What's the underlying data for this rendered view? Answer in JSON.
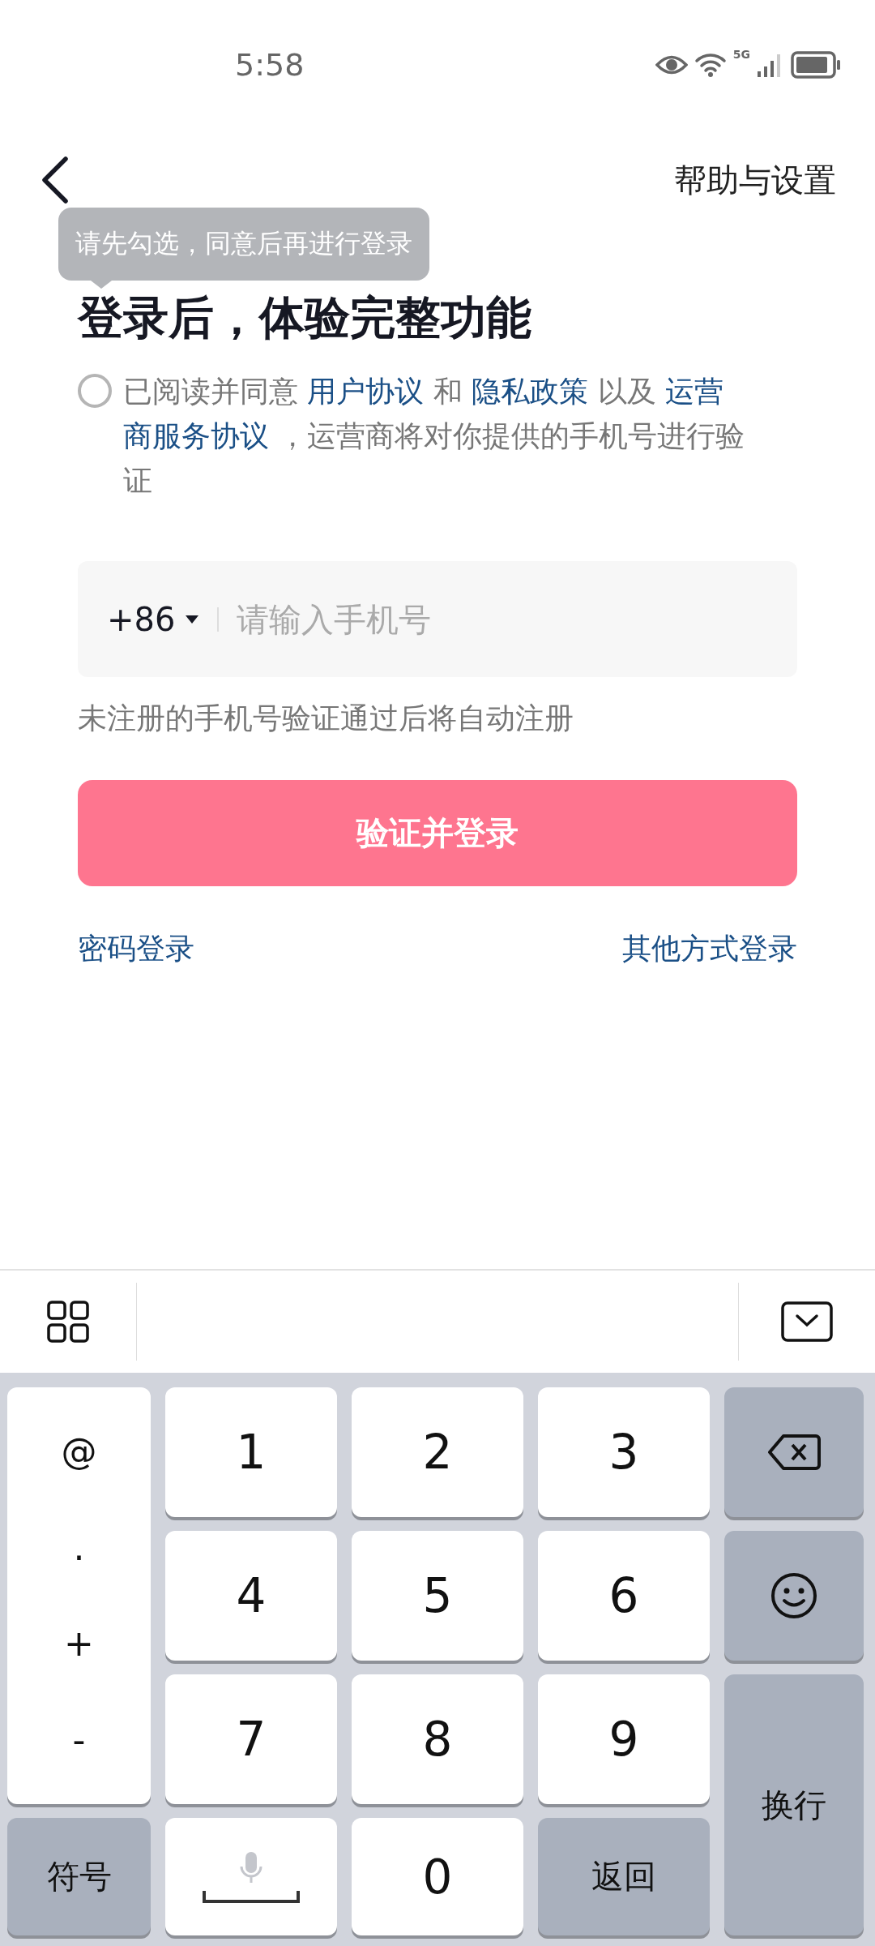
{
  "status_bar": {
    "time": "5:58",
    "network": "5G"
  },
  "header": {
    "help_link": "帮助与设置"
  },
  "tooltip": {
    "text": "请先勾选，同意后再进行登录"
  },
  "title": "登录后，体验完整功能",
  "agreement": {
    "checked": false,
    "segments": [
      {
        "text": "已阅读并同意 ",
        "link": false
      },
      {
        "text": "用户协议",
        "link": true
      },
      {
        "text": " 和 ",
        "link": false
      },
      {
        "text": "隐私政策",
        "link": true
      },
      {
        "text": " 以及 ",
        "link": false
      },
      {
        "text": "运营",
        "link": true
      },
      {
        "text": "商服务协议",
        "link": true
      },
      {
        "text": " ，运营商将对你提供的手机号进行验证",
        "link": false
      }
    ]
  },
  "phone_field": {
    "country_code": "+86",
    "placeholder": "请输入手机号"
  },
  "hint": "未注册的手机号验证通过后将自动注册",
  "submit_button": "验证并登录",
  "links": [
    "密码登录",
    "其他方式登录"
  ],
  "keyboard": {
    "keys": [
      {
        "kind": "symbols",
        "labels": [
          "@",
          ".",
          "+",
          "-"
        ]
      },
      {
        "kind": "digit",
        "label": "1"
      },
      {
        "kind": "digit",
        "label": "2"
      },
      {
        "kind": "digit",
        "label": "3"
      },
      {
        "kind": "delete"
      },
      {
        "kind": "digit",
        "label": "4"
      },
      {
        "kind": "digit",
        "label": "5"
      },
      {
        "kind": "digit",
        "label": "6"
      },
      {
        "kind": "emoji"
      },
      {
        "kind": "digit",
        "label": "7"
      },
      {
        "kind": "digit",
        "label": "8"
      },
      {
        "kind": "digit",
        "label": "9"
      },
      {
        "kind": "enter",
        "label": "换行"
      },
      {
        "kind": "function",
        "label": "符号"
      },
      {
        "kind": "space"
      },
      {
        "kind": "digit",
        "label": "0"
      },
      {
        "kind": "function",
        "label": "返回"
      }
    ]
  }
}
